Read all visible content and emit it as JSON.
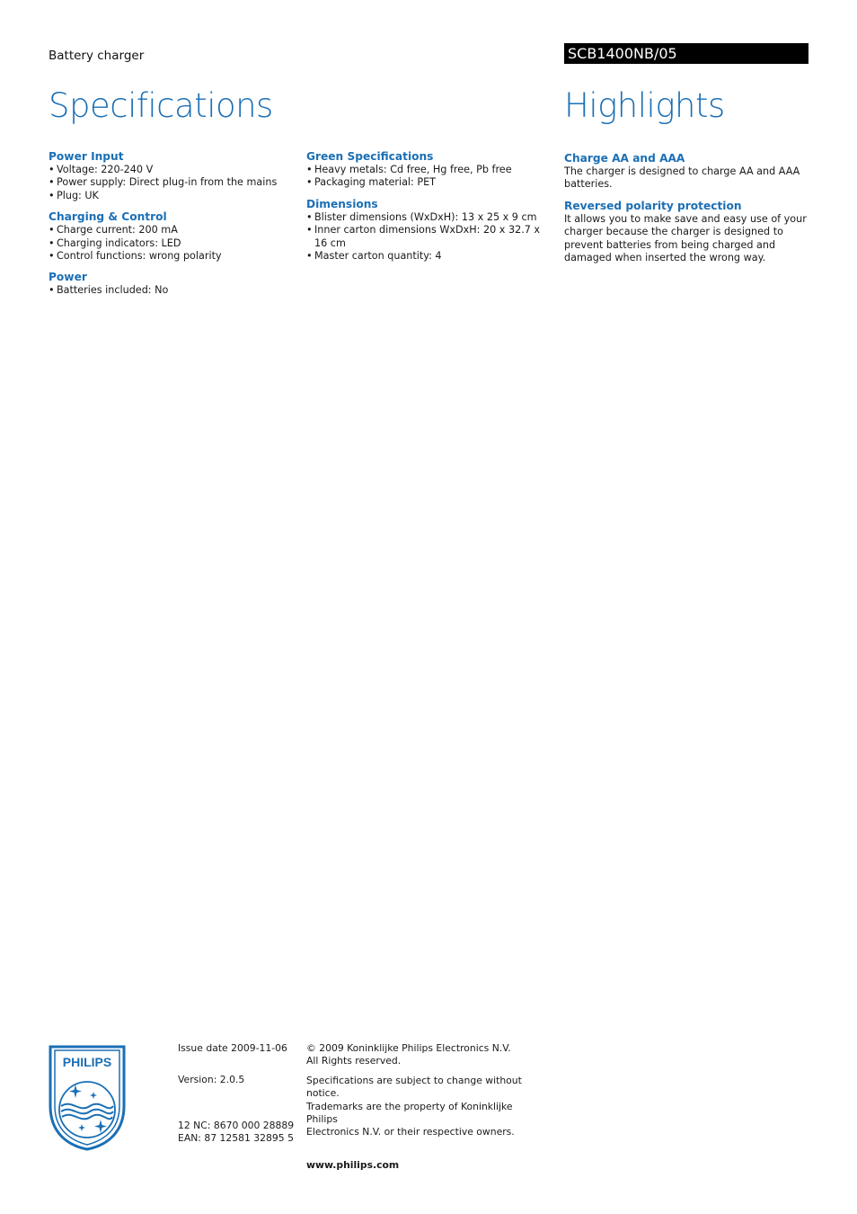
{
  "header": {
    "subtitle": "Battery charger",
    "model": "SCB1400NB/05",
    "specifications_title": "Specifications",
    "highlights_title": "Highlights"
  },
  "specifications": {
    "column1": [
      {
        "heading": "Power Input",
        "items": [
          "Voltage: 220-240 V",
          "Power supply: Direct plug-in from the mains",
          "Plug: UK"
        ]
      },
      {
        "heading": "Charging & Control",
        "items": [
          "Charge current: 200 mA",
          "Charging indicators: LED",
          "Control functions: wrong polarity"
        ]
      },
      {
        "heading": "Power",
        "items": [
          "Batteries included: No"
        ]
      }
    ],
    "column2": [
      {
        "heading": "Green Specifications",
        "items": [
          "Heavy metals: Cd free, Hg free, Pb free",
          "Packaging material: PET"
        ]
      },
      {
        "heading": "Dimensions",
        "items": [
          "Blister dimensions (WxDxH): 13 x 25 x 9 cm",
          "Inner carton dimensions WxDxH: 20 x 32.7 x 16 cm",
          "Master carton quantity: 4"
        ]
      }
    ]
  },
  "highlights": [
    {
      "heading": "Charge AA and AAA",
      "text": "The charger is designed to charge AA and AAA batteries."
    },
    {
      "heading": "Reversed polarity protection",
      "text": "It allows you to make save and easy use of your charger because the charger is designed to prevent batteries from being charged and damaged when inserted the wrong way."
    }
  ],
  "footer": {
    "logo_text": "PHILIPS",
    "brand_color": "#1b6fb5",
    "issue_date": "Issue date 2009-11-06",
    "version": "Version: 2.0.5",
    "nc": "12 NC: 8670 000 28889",
    "ean": "EAN: 87 12581 32895 5",
    "copyright_line1": "© 2009 Koninklijke Philips Electronics N.V.",
    "copyright_line2": "All Rights reserved.",
    "notice_line1": "Specifications are subject to change without notice.",
    "notice_line2": "Trademarks are the property of Koninklijke Philips",
    "notice_line3": "Electronics N.V. or their respective owners.",
    "website": "www.philips.com"
  }
}
